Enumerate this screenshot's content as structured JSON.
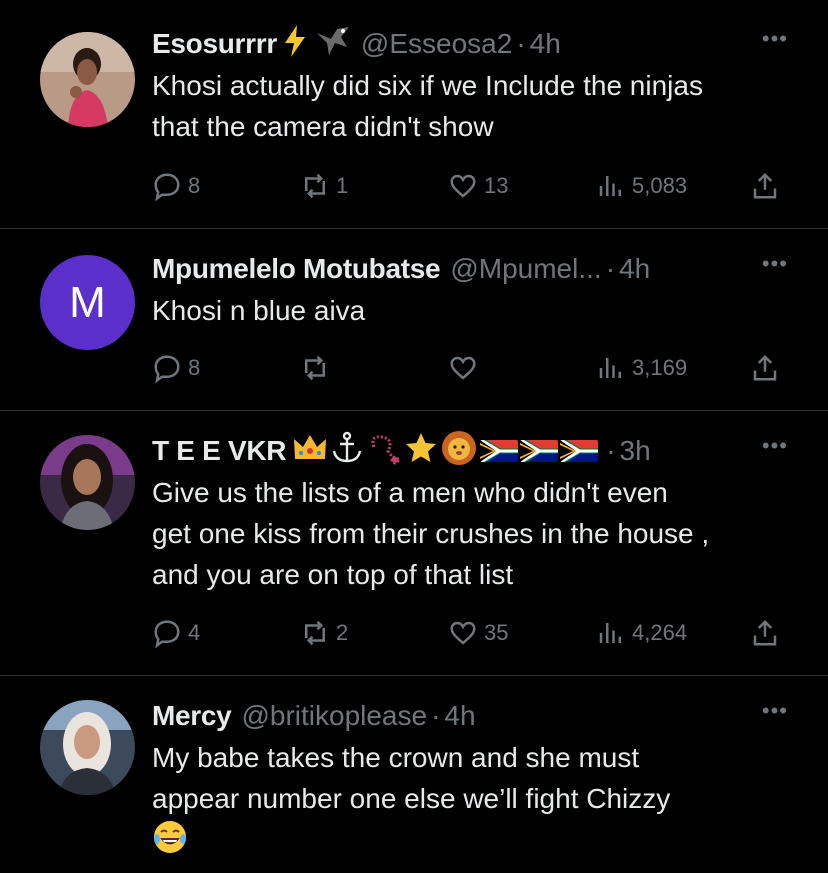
{
  "tweets": [
    {
      "name": "Esosurrrr",
      "badges": [
        "⚡",
        "🦅"
      ],
      "handle": "@Esseosa2",
      "time": "4h",
      "text_lines": [
        "Khosi actually did six if we Include the ninjas",
        "that the camera didn't show"
      ],
      "replies": "8",
      "retweets": "1",
      "likes": "13",
      "views": "5,083"
    },
    {
      "name": "Mpumelelo Motubatse",
      "handle": "@Mpumel...",
      "time": "4h",
      "avatar_letter": "M",
      "text_lines": [
        "Khosi n blue aiva"
      ],
      "replies": "8",
      "retweets": "",
      "likes": "",
      "views": "3,169"
    },
    {
      "name": "T E E VKR",
      "badges": [
        "👑",
        "⚓",
        "📿",
        "⭐",
        "🦁",
        "🇿🇦",
        "🇿🇦",
        "🇿🇦"
      ],
      "handle": "",
      "time": "3h",
      "text_lines": [
        "Give us the lists of a men who didn't even",
        "get one kiss from their crushes in the house ,",
        "and you are on top of that list"
      ],
      "replies": "4",
      "retweets": "2",
      "likes": "35",
      "views": "4,264"
    },
    {
      "name": "Mercy",
      "handle": "@britikoplease",
      "time": "4h",
      "text_lines": [
        "My babe takes the crown and she must",
        "appear number one else we’ll fight Chizzy"
      ],
      "trailing_emoji": "😂"
    }
  ],
  "colors": {
    "background": "#000000",
    "text": "#e7e9ea",
    "muted": "#71767b",
    "divider": "#2f3336",
    "avatar_purple": "#5b2fc9"
  },
  "icons": {
    "reply": "reply-icon",
    "retweet": "retweet-icon",
    "like": "heart-icon",
    "views": "views-icon",
    "share": "share-icon",
    "more": "more-icon"
  },
  "more_label": "•••",
  "dot_separator": "·"
}
